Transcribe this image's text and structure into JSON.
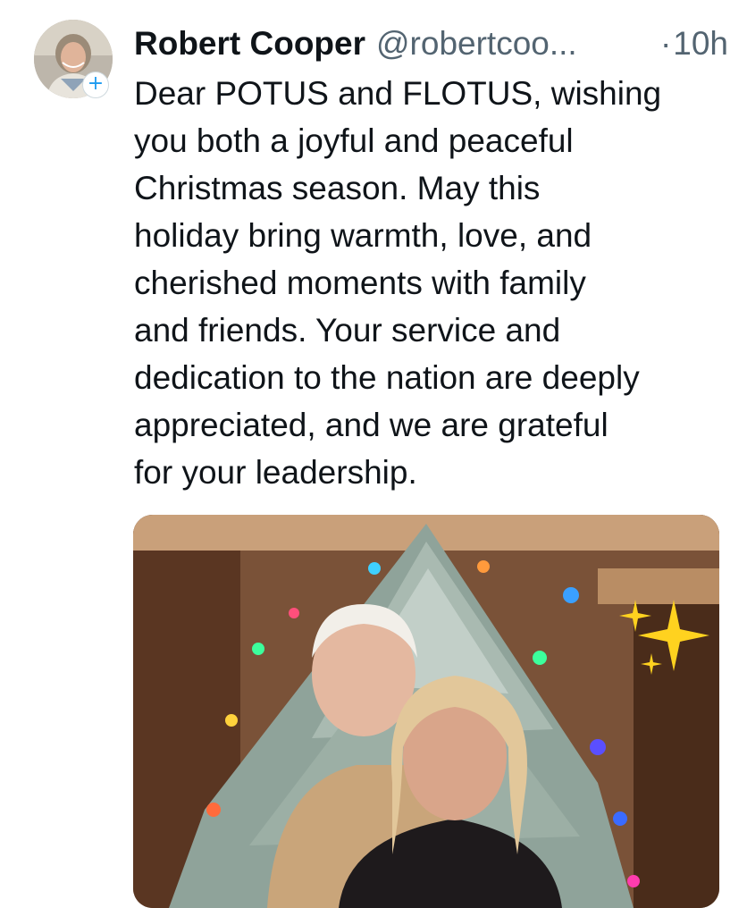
{
  "tweet": {
    "author_name": "Robert Cooper",
    "handle": "@robertcoo...",
    "separator": "·",
    "time": "10h",
    "follow_glyph": "+",
    "text_lines": [
      "Dear POTUS and FLOTUS, wishing",
      "you both a joyful and peaceful",
      "Christmas season. May this",
      "holiday bring warmth, love, and",
      "cherished moments with family",
      "and friends. Your service and",
      "dedication to the nation are deeply",
      "appreciated, and we are grateful",
      "for your leadership."
    ]
  },
  "icons": {
    "follow": "plus-icon",
    "sparkle": "sparkle-icon"
  },
  "colors": {
    "text": "#0f1419",
    "secondary": "#536471",
    "accent": "#1d9bf0"
  }
}
